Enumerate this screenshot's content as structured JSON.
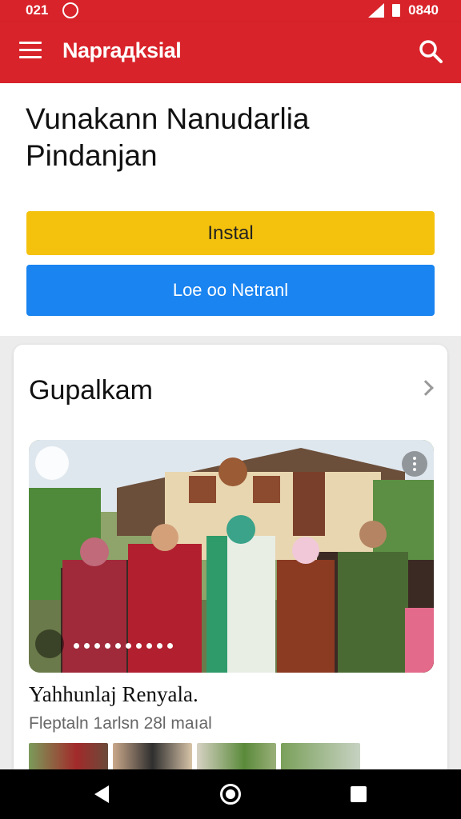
{
  "status_bar": {
    "time": "021",
    "right_text": "0840"
  },
  "app_bar": {
    "title": "Naprадksiаl",
    "menu_icon": "hamburger-menu-icon",
    "search_icon": "search-icon"
  },
  "hero": {
    "title": "Vunakann Nanudarlia Pindanjan",
    "install_label": "Instal",
    "secondary_label": "Loe oo Netranl"
  },
  "card": {
    "title": "Gupalkam",
    "post_title": "Yahhunlaj Renyala.",
    "post_subtitle": "Fleptaln 1arlsn 28l maıal"
  },
  "colors": {
    "brand_red": "#d8232a",
    "install_yellow": "#f4c20d",
    "action_blue": "#1a84f0"
  }
}
